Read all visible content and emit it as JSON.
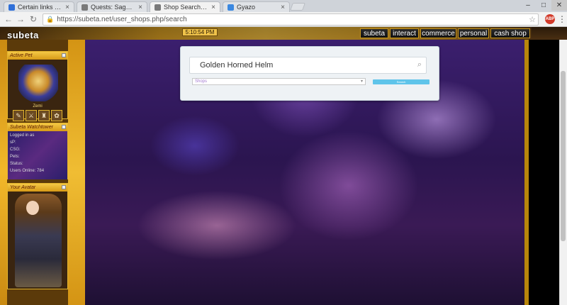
{
  "browser": {
    "tabs": [
      {
        "title": "Certain links want to do",
        "active": false,
        "favicon_color": "#2f6fd8"
      },
      {
        "title": "Quests: Saggitarius - Sub",
        "active": false,
        "favicon_color": "#7a7a7a"
      },
      {
        "title": "Shop Search - Subeta",
        "active": true,
        "favicon_color": "#7a7a7a"
      },
      {
        "title": "Gyazo",
        "active": false,
        "favicon_color": "#3b88e0"
      }
    ],
    "url": "https://subeta.net/user_shops.php/search",
    "extension_badge": "ABP"
  },
  "site": {
    "logo": "subeta",
    "clock": "5:10:54 PM",
    "nav": [
      "subeta",
      "interact",
      "commerce",
      "personal",
      "cash shop"
    ]
  },
  "sidebar": {
    "active_pet": {
      "title": "Active Pet",
      "name": "Zemi",
      "items": [
        "item-1",
        "item-2",
        "item-3",
        "item-4"
      ]
    },
    "watchtower": {
      "title": "Subeta Watchtower",
      "lines": [
        {
          "label": "Logged in as",
          "value": ""
        },
        {
          "label": "sP:",
          "value": ""
        },
        {
          "label": "CSG:",
          "value": ""
        },
        {
          "label": "Pets:",
          "value": ""
        },
        {
          "label": "Status:",
          "value": ""
        },
        {
          "label": "Users Online:",
          "value": "784"
        }
      ]
    },
    "avatar": {
      "title": "Your Avatar"
    }
  },
  "search": {
    "query": "Golden Horned Helm",
    "filter_placeholder": "Shops",
    "button_label": "Search"
  },
  "colors": {
    "gold": "#f0bd33",
    "search_button": "#5fc4ea",
    "nebula": "#3b1f6e"
  }
}
